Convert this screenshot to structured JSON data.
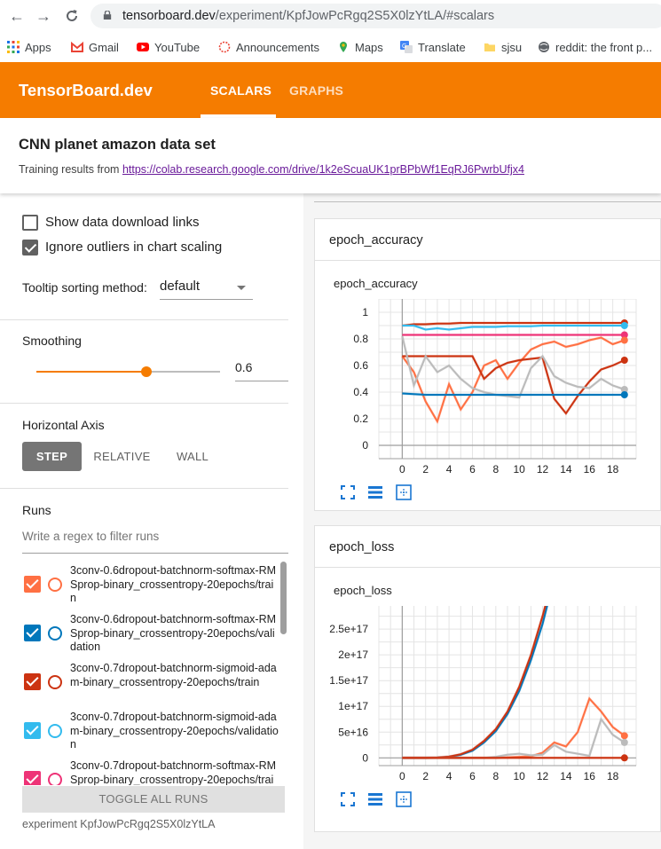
{
  "browser": {
    "url_host": "tensorboard.dev",
    "url_path": "/experiment/KpfJowPcRgq2S5X0lzYtLA/#scalars",
    "bookmarks": [
      {
        "label": "Apps",
        "icon": "apps-grid-icon"
      },
      {
        "label": "Gmail",
        "icon": "gmail-icon"
      },
      {
        "label": "YouTube",
        "icon": "youtube-icon"
      },
      {
        "label": "Announcements",
        "icon": "announcements-icon"
      },
      {
        "label": "Maps",
        "icon": "maps-pin-icon"
      },
      {
        "label": "Translate",
        "icon": "translate-icon"
      },
      {
        "label": "sjsu",
        "icon": "folder-icon"
      },
      {
        "label": "reddit: the front p...",
        "icon": "globe-icon"
      }
    ]
  },
  "app": {
    "brand": "TensorBoard.dev",
    "tabs": [
      {
        "label": "SCALARS",
        "active": true
      },
      {
        "label": "GRAPHS",
        "active": false
      }
    ],
    "accent": "#f57c00"
  },
  "experiment": {
    "title": "CNN planet amazon data set",
    "desc_prefix": "Training results from ",
    "desc_link": "https://colab.research.google.com/drive/1k2eScuaUK1prBPbWf1EqRJ6PwrbUfjx4",
    "footer_id": "experiment KpfJowPcRgq2S5X0lzYtLA"
  },
  "sidebar": {
    "show_download_label": "Show data download links",
    "show_download_checked": false,
    "ignore_outliers_label": "Ignore outliers in chart scaling",
    "ignore_outliers_checked": true,
    "tooltip_label": "Tooltip sorting method:",
    "tooltip_value": "default",
    "smoothing_label": "Smoothing",
    "smoothing_value": "0.6",
    "smoothing_fraction": 0.6,
    "haxis_label": "Horizontal Axis",
    "haxis_options": [
      {
        "label": "STEP",
        "active": true
      },
      {
        "label": "RELATIVE",
        "active": false
      },
      {
        "label": "WALL",
        "active": false
      }
    ],
    "runs_label": "Runs",
    "regex_placeholder": "Write a regex to filter runs",
    "runs": [
      {
        "name": "3conv-0.6dropout-batchnorm-softmax-RMSprop-binary_crossentropy-20epochs/train",
        "color": "#ff7043",
        "checked": true
      },
      {
        "name": "3conv-0.6dropout-batchnorm-softmax-RMSprop-binary_crossentropy-20epochs/validation",
        "color": "#0077bb",
        "checked": true
      },
      {
        "name": "3conv-0.7dropout-batchnorm-sigmoid-adam-binary_crossentropy-20epochs/train",
        "color": "#cc3311",
        "checked": true
      },
      {
        "name": "3conv-0.7dropout-batchnorm-sigmoid-adam-binary_crossentropy-20epochs/validation",
        "color": "#33bbee",
        "checked": true
      },
      {
        "name": "3conv-0.7dropout-batchnorm-softmax-RMSprop-binary_crossentropy-20epochs/train",
        "color": "#ee3377",
        "checked": true
      }
    ],
    "toggle_all_label": "TOGGLE ALL RUNS"
  },
  "cards": [
    {
      "header": "epoch_accuracy",
      "chart_title": "epoch_accuracy"
    },
    {
      "header": "epoch_loss",
      "chart_title": "epoch_loss"
    }
  ],
  "chart_data": [
    {
      "type": "line",
      "title": "epoch_accuracy",
      "xlabel": "",
      "ylabel": "",
      "x_ticks": [
        0,
        2,
        4,
        6,
        8,
        10,
        12,
        14,
        16,
        18
      ],
      "y_ticks": [
        "0",
        "0.2",
        "0.4",
        "0.6",
        "0.8",
        "1"
      ],
      "xlim": [
        -2,
        20
      ],
      "ylim": [
        -0.1,
        1.1
      ],
      "grid": true,
      "series": [
        {
          "color": "#cc3311",
          "values": [
            0.9,
            0.91,
            0.91,
            0.915,
            0.915,
            0.92,
            0.92,
            0.92,
            0.92,
            0.92,
            0.92,
            0.92,
            0.92,
            0.92,
            0.92,
            0.92,
            0.92,
            0.92,
            0.92,
            0.92
          ]
        },
        {
          "color": "#33bbee",
          "values": [
            0.9,
            0.9,
            0.87,
            0.88,
            0.87,
            0.88,
            0.89,
            0.89,
            0.89,
            0.895,
            0.895,
            0.895,
            0.9,
            0.9,
            0.9,
            0.9,
            0.9,
            0.9,
            0.9,
            0.9
          ]
        },
        {
          "color": "#ee3377",
          "values": [
            0.83,
            0.83,
            0.83,
            0.83,
            0.83,
            0.83,
            0.83,
            0.83,
            0.83,
            0.83,
            0.83,
            0.83,
            0.83,
            0.83,
            0.83,
            0.83,
            0.83,
            0.83,
            0.83,
            0.83
          ]
        },
        {
          "color": "#ff7043",
          "values": [
            0.67,
            0.55,
            0.33,
            0.18,
            0.46,
            0.27,
            0.4,
            0.6,
            0.64,
            0.5,
            0.62,
            0.72,
            0.76,
            0.78,
            0.74,
            0.76,
            0.79,
            0.81,
            0.76,
            0.79
          ]
        },
        {
          "color": "#cc3311",
          "values": [
            0.67,
            0.67,
            0.67,
            0.67,
            0.67,
            0.67,
            0.67,
            0.5,
            0.58,
            0.62,
            0.64,
            0.65,
            0.66,
            0.35,
            0.24,
            0.37,
            0.48,
            0.57,
            0.6,
            0.64
          ]
        },
        {
          "color": "#bbbbbb",
          "values": [
            0.82,
            0.45,
            0.67,
            0.55,
            0.6,
            0.5,
            0.43,
            0.4,
            0.38,
            0.37,
            0.36,
            0.58,
            0.67,
            0.52,
            0.47,
            0.44,
            0.43,
            0.5,
            0.45,
            0.42
          ]
        },
        {
          "color": "#0077bb",
          "values": [
            0.39,
            0.385,
            0.38,
            0.38,
            0.38,
            0.38,
            0.38,
            0.38,
            0.38,
            0.38,
            0.38,
            0.38,
            0.38,
            0.38,
            0.38,
            0.38,
            0.38,
            0.38,
            0.38,
            0.38
          ]
        }
      ]
    },
    {
      "type": "line",
      "title": "epoch_loss",
      "xlabel": "",
      "ylabel": "",
      "x_ticks": [
        0,
        2,
        4,
        6,
        8,
        10,
        12,
        14,
        16,
        18
      ],
      "y_ticks": [
        "0",
        "5e+16",
        "1e+17",
        "1.5e+17",
        "2e+17",
        "2.5e+17"
      ],
      "y_tick_values": [
        0,
        5e+16,
        1e+17,
        1.5e+17,
        2e+17,
        2.5e+17
      ],
      "xlim": [
        -2,
        20
      ],
      "ylim": [
        -1.5e+16,
        2.95e+17
      ],
      "grid": true,
      "series": [
        {
          "color": "#0077bb",
          "values": [
            0,
            0,
            0,
            500000000000000.0,
            2000000000000000.0,
            6000000000000000.0,
            1.4e+16,
            3e+16,
            5.2e+16,
            8.5e+16,
            1.3e+17,
            1.9e+17,
            2.6e+17,
            3.5e+17,
            null,
            null,
            null,
            null,
            null,
            null
          ]
        },
        {
          "color": "#cc3311",
          "values": [
            0,
            0,
            0,
            600000000000000.0,
            2400000000000000.0,
            7000000000000000.0,
            1.6e+16,
            3.3e+16,
            5.6e+16,
            9e+16,
            1.38e+17,
            2e+17,
            2.75e+17,
            3.6e+17,
            null,
            null,
            null,
            null,
            null,
            null
          ]
        },
        {
          "color": "#ff7043",
          "values": [
            0,
            0,
            0,
            0,
            0,
            0,
            0,
            0,
            0,
            1000000000000000.0,
            2000000000000000.0,
            3000000000000000.0,
            1e+16,
            3e+16,
            2.2e+16,
            5e+16,
            1.15e+17,
            9e+16,
            6e+16,
            4.3e+16
          ]
        },
        {
          "color": "#bbbbbb",
          "values": [
            0,
            0,
            0,
            0,
            0,
            0,
            0,
            0,
            2000000000000000.0,
            6000000000000000.0,
            8000000000000000.0,
            5000000000000000.0,
            6000000000000000.0,
            2.5e+16,
            1.2e+16,
            8000000000000000.0,
            4000000000000000.0,
            7.5e+16,
            4.5e+16,
            3e+16
          ]
        },
        {
          "color": "#cc3311",
          "values": [
            0,
            0,
            0,
            0,
            0,
            0,
            0,
            0,
            0,
            0,
            0,
            0,
            0,
            0,
            0,
            0,
            0,
            0,
            0,
            0
          ]
        }
      ]
    }
  ]
}
